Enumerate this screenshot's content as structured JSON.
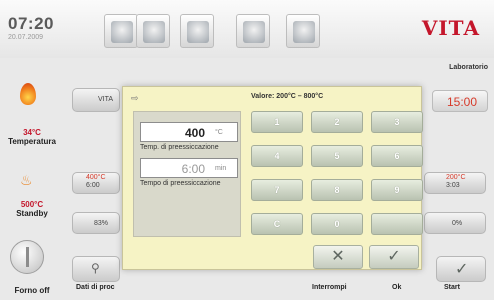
{
  "header": {
    "time": "07:20",
    "date": "20.07.2009",
    "brand": "VITA",
    "program_name": "Laboratorio"
  },
  "status": {
    "temperature_value": "34°C",
    "temperature_label": "Temperatura",
    "standby_value": "500°C",
    "standby_label": "Standby",
    "power_label": "Forno off"
  },
  "background": {
    "program_title_fragment": "VITA",
    "end_time": "15:00",
    "start_label": "Start",
    "process_data_label": "Dati di proc",
    "row_left_value_a": "400°C",
    "row_left_value_b": "6:00",
    "row_right_value_a": "200°C",
    "row_right_value_b": "3:03",
    "percent_left": "83%",
    "percent_right": "0%"
  },
  "dialog": {
    "range_text": "Valore: 200°C – 800°C",
    "temp_value": "400",
    "temp_unit": "°C",
    "temp_label": "Temp. di preessiccazione",
    "time_value": "6:00",
    "time_unit": "min",
    "time_label": "Tempo di preessiccazione",
    "keys": [
      "1",
      "2",
      "3",
      "4",
      "5",
      "6",
      "7",
      "8",
      "9",
      "C",
      "0",
      ""
    ],
    "cancel_label": "Interrompi",
    "ok_label": "Ok",
    "cancel_icon": "close-x-icon",
    "ok_icon": "check-icon"
  }
}
